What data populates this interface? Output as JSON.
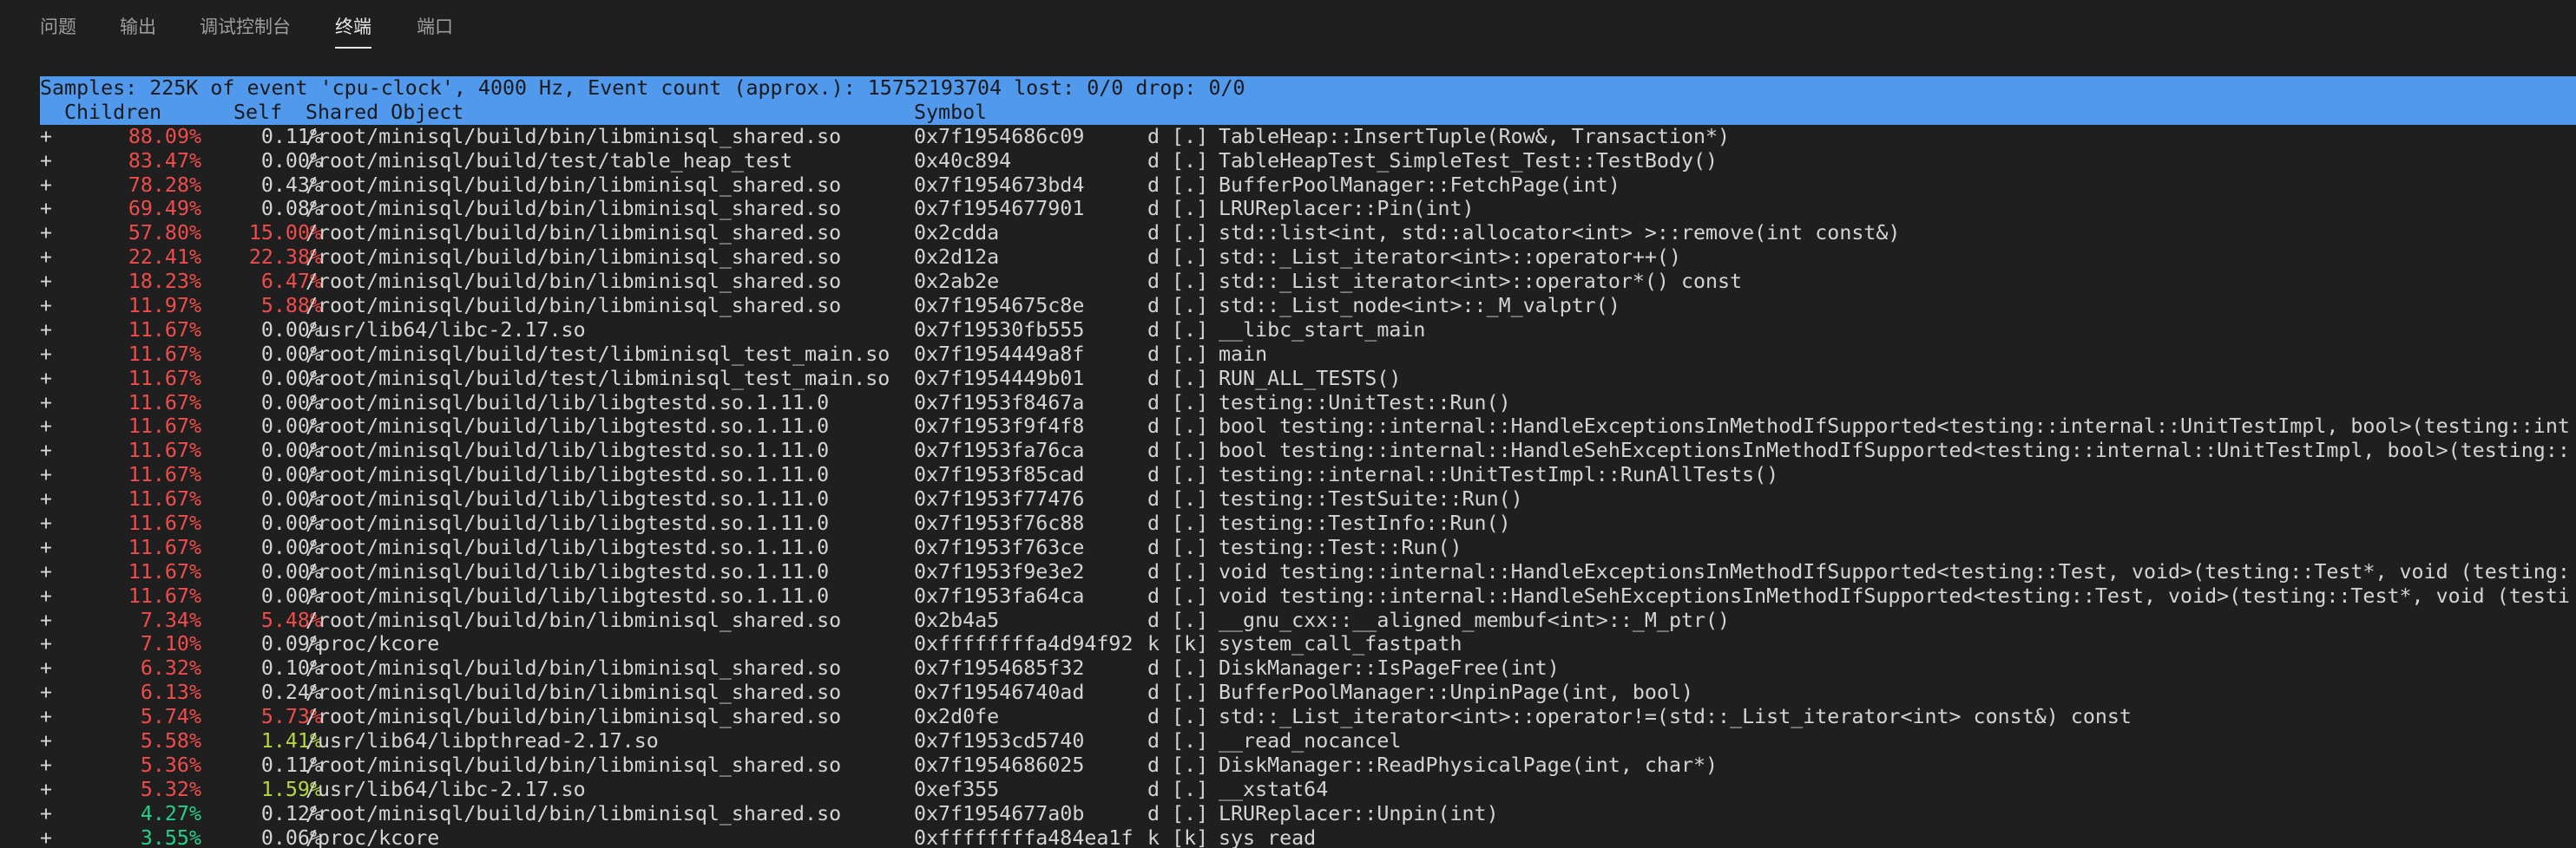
{
  "panel": {
    "tabs": [
      {
        "label": "问题",
        "active": false
      },
      {
        "label": "输出",
        "active": false
      },
      {
        "label": "调试控制台",
        "active": false
      },
      {
        "label": "终端",
        "active": true
      },
      {
        "label": "端口",
        "active": false
      }
    ]
  },
  "colors": {
    "background": "#1f1f1f",
    "header_highlight": "#5199ec",
    "percent_red": "#f14c4c",
    "percent_green": "#23d18b",
    "percent_lime": "#b5d840",
    "text": "#d4d4d4"
  },
  "terminal": {
    "summary": "Samples: 225K of event 'cpu-clock', 4000 Hz, Event count (approx.): 15752193704 lost: 0/0 drop: 0/0",
    "columns": {
      "children": "Children",
      "self": "Self",
      "shared_object": "Shared Object",
      "symbol": "Symbol"
    },
    "rows": [
      {
        "plus": "+",
        "children": "88.09%",
        "children_color": "red",
        "self": "0.11%",
        "self_color": "none",
        "object": "/root/minisql/build/bin/libminisql_shared.so",
        "address": "0x7f1954686c09",
        "mode": "d [.]",
        "symbol": "TableHeap::InsertTuple(Row&, Transaction*)"
      },
      {
        "plus": "+",
        "children": "83.47%",
        "children_color": "red",
        "self": "0.00%",
        "self_color": "none",
        "object": "/root/minisql/build/test/table_heap_test",
        "address": "0x40c894",
        "mode": "d [.]",
        "symbol": "TableHeapTest_SimpleTest_Test::TestBody()"
      },
      {
        "plus": "+",
        "children": "78.28%",
        "children_color": "red",
        "self": "0.43%",
        "self_color": "none",
        "object": "/root/minisql/build/bin/libminisql_shared.so",
        "address": "0x7f1954673bd4",
        "mode": "d [.]",
        "symbol": "BufferPoolManager::FetchPage(int)"
      },
      {
        "plus": "+",
        "children": "69.49%",
        "children_color": "red",
        "self": "0.08%",
        "self_color": "none",
        "object": "/root/minisql/build/bin/libminisql_shared.so",
        "address": "0x7f1954677901",
        "mode": "d [.]",
        "symbol": "LRUReplacer::Pin(int)"
      },
      {
        "plus": "+",
        "children": "57.80%",
        "children_color": "red",
        "self": "15.00%",
        "self_color": "red",
        "object": "/root/minisql/build/bin/libminisql_shared.so",
        "address": "0x2cdda",
        "mode": "d [.]",
        "symbol": "std::list<int, std::allocator<int> >::remove(int const&)"
      },
      {
        "plus": "+",
        "children": "22.41%",
        "children_color": "red",
        "self": "22.38%",
        "self_color": "red",
        "object": "/root/minisql/build/bin/libminisql_shared.so",
        "address": "0x2d12a",
        "mode": "d [.]",
        "symbol": "std::_List_iterator<int>::operator++()"
      },
      {
        "plus": "+",
        "children": "18.23%",
        "children_color": "red",
        "self": "6.47%",
        "self_color": "red",
        "object": "/root/minisql/build/bin/libminisql_shared.so",
        "address": "0x2ab2e",
        "mode": "d [.]",
        "symbol": "std::_List_iterator<int>::operator*() const"
      },
      {
        "plus": "+",
        "children": "11.97%",
        "children_color": "red",
        "self": "5.88%",
        "self_color": "red",
        "object": "/root/minisql/build/bin/libminisql_shared.so",
        "address": "0x7f1954675c8e",
        "mode": "d [.]",
        "symbol": "std::_List_node<int>::_M_valptr()"
      },
      {
        "plus": "+",
        "children": "11.67%",
        "children_color": "red",
        "self": "0.00%",
        "self_color": "none",
        "object": "/usr/lib64/libc-2.17.so",
        "address": "0x7f19530fb555",
        "mode": "d [.]",
        "symbol": "__libc_start_main"
      },
      {
        "plus": "+",
        "children": "11.67%",
        "children_color": "red",
        "self": "0.00%",
        "self_color": "none",
        "object": "/root/minisql/build/test/libminisql_test_main.so",
        "address": "0x7f1954449a8f",
        "mode": "d [.]",
        "symbol": "main"
      },
      {
        "plus": "+",
        "children": "11.67%",
        "children_color": "red",
        "self": "0.00%",
        "self_color": "none",
        "object": "/root/minisql/build/test/libminisql_test_main.so",
        "address": "0x7f1954449b01",
        "mode": "d [.]",
        "symbol": "RUN_ALL_TESTS()"
      },
      {
        "plus": "+",
        "children": "11.67%",
        "children_color": "red",
        "self": "0.00%",
        "self_color": "none",
        "object": "/root/minisql/build/lib/libgtestd.so.1.11.0",
        "address": "0x7f1953f8467a",
        "mode": "d [.]",
        "symbol": "testing::UnitTest::Run()"
      },
      {
        "plus": "+",
        "children": "11.67%",
        "children_color": "red",
        "self": "0.00%",
        "self_color": "none",
        "object": "/root/minisql/build/lib/libgtestd.so.1.11.0",
        "address": "0x7f1953f9f4f8",
        "mode": "d [.]",
        "symbol": "bool testing::internal::HandleExceptionsInMethodIfSupported<testing::internal::UnitTestImpl, bool>(testing::int"
      },
      {
        "plus": "+",
        "children": "11.67%",
        "children_color": "red",
        "self": "0.00%",
        "self_color": "none",
        "object": "/root/minisql/build/lib/libgtestd.so.1.11.0",
        "address": "0x7f1953fa76ca",
        "mode": "d [.]",
        "symbol": "bool testing::internal::HandleSehExceptionsInMethodIfSupported<testing::internal::UnitTestImpl, bool>(testing::"
      },
      {
        "plus": "+",
        "children": "11.67%",
        "children_color": "red",
        "self": "0.00%",
        "self_color": "none",
        "object": "/root/minisql/build/lib/libgtestd.so.1.11.0",
        "address": "0x7f1953f85cad",
        "mode": "d [.]",
        "symbol": "testing::internal::UnitTestImpl::RunAllTests()"
      },
      {
        "plus": "+",
        "children": "11.67%",
        "children_color": "red",
        "self": "0.00%",
        "self_color": "none",
        "object": "/root/minisql/build/lib/libgtestd.so.1.11.0",
        "address": "0x7f1953f77476",
        "mode": "d [.]",
        "symbol": "testing::TestSuite::Run()"
      },
      {
        "plus": "+",
        "children": "11.67%",
        "children_color": "red",
        "self": "0.00%",
        "self_color": "none",
        "object": "/root/minisql/build/lib/libgtestd.so.1.11.0",
        "address": "0x7f1953f76c88",
        "mode": "d [.]",
        "symbol": "testing::TestInfo::Run()"
      },
      {
        "plus": "+",
        "children": "11.67%",
        "children_color": "red",
        "self": "0.00%",
        "self_color": "none",
        "object": "/root/minisql/build/lib/libgtestd.so.1.11.0",
        "address": "0x7f1953f763ce",
        "mode": "d [.]",
        "symbol": "testing::Test::Run()"
      },
      {
        "plus": "+",
        "children": "11.67%",
        "children_color": "red",
        "self": "0.00%",
        "self_color": "none",
        "object": "/root/minisql/build/lib/libgtestd.so.1.11.0",
        "address": "0x7f1953f9e3e2",
        "mode": "d [.]",
        "symbol": "void testing::internal::HandleExceptionsInMethodIfSupported<testing::Test, void>(testing::Test*, void (testing:"
      },
      {
        "plus": "+",
        "children": "11.67%",
        "children_color": "red",
        "self": "0.00%",
        "self_color": "none",
        "object": "/root/minisql/build/lib/libgtestd.so.1.11.0",
        "address": "0x7f1953fa64ca",
        "mode": "d [.]",
        "symbol": "void testing::internal::HandleSehExceptionsInMethodIfSupported<testing::Test, void>(testing::Test*, void (testi"
      },
      {
        "plus": "+",
        "children": "7.34%",
        "children_color": "red",
        "self": "5.48%",
        "self_color": "red",
        "object": "/root/minisql/build/bin/libminisql_shared.so",
        "address": "0x2b4a5",
        "mode": "d [.]",
        "symbol": "__gnu_cxx::__aligned_membuf<int>::_M_ptr()"
      },
      {
        "plus": "+",
        "children": "7.10%",
        "children_color": "red",
        "self": "0.09%",
        "self_color": "none",
        "object": "/proc/kcore",
        "address": "0xffffffffa4d94f92",
        "mode": "k [k]",
        "symbol": "system_call_fastpath"
      },
      {
        "plus": "+",
        "children": "6.32%",
        "children_color": "red",
        "self": "0.10%",
        "self_color": "none",
        "object": "/root/minisql/build/bin/libminisql_shared.so",
        "address": "0x7f1954685f32",
        "mode": "d [.]",
        "symbol": "DiskManager::IsPageFree(int)"
      },
      {
        "plus": "+",
        "children": "6.13%",
        "children_color": "red",
        "self": "0.24%",
        "self_color": "none",
        "object": "/root/minisql/build/bin/libminisql_shared.so",
        "address": "0x7f19546740ad",
        "mode": "d [.]",
        "symbol": "BufferPoolManager::UnpinPage(int, bool)"
      },
      {
        "plus": "+",
        "children": "5.74%",
        "children_color": "red",
        "self": "5.73%",
        "self_color": "red",
        "object": "/root/minisql/build/bin/libminisql_shared.so",
        "address": "0x2d0fe",
        "mode": "d [.]",
        "symbol": "std::_List_iterator<int>::operator!=(std::_List_iterator<int> const&) const"
      },
      {
        "plus": "+",
        "children": "5.58%",
        "children_color": "red",
        "self": "1.41%",
        "self_color": "lime",
        "object": "/usr/lib64/libpthread-2.17.so",
        "address": "0x7f1953cd5740",
        "mode": "d [.]",
        "symbol": "__read_nocancel"
      },
      {
        "plus": "+",
        "children": "5.36%",
        "children_color": "red",
        "self": "0.11%",
        "self_color": "none",
        "object": "/root/minisql/build/bin/libminisql_shared.so",
        "address": "0x7f1954686025",
        "mode": "d [.]",
        "symbol": "DiskManager::ReadPhysicalPage(int, char*)"
      },
      {
        "plus": "+",
        "children": "5.32%",
        "children_color": "red",
        "self": "1.59%",
        "self_color": "lime",
        "object": "/usr/lib64/libc-2.17.so",
        "address": "0xef355",
        "mode": "d [.]",
        "symbol": "__xstat64"
      },
      {
        "plus": "+",
        "children": "4.27%",
        "children_color": "green",
        "self": "0.12%",
        "self_color": "none",
        "object": "/root/minisql/build/bin/libminisql_shared.so",
        "address": "0x7f1954677a0b",
        "mode": "d [.]",
        "symbol": "LRUReplacer::Unpin(int)"
      },
      {
        "plus": "+",
        "children": "3.55%",
        "children_color": "green",
        "self": "0.06%",
        "self_color": "none",
        "object": "/proc/kcore",
        "address": "0xffffffffa484ea1f",
        "mode": "k [k]",
        "symbol": "sys_read"
      }
    ]
  }
}
